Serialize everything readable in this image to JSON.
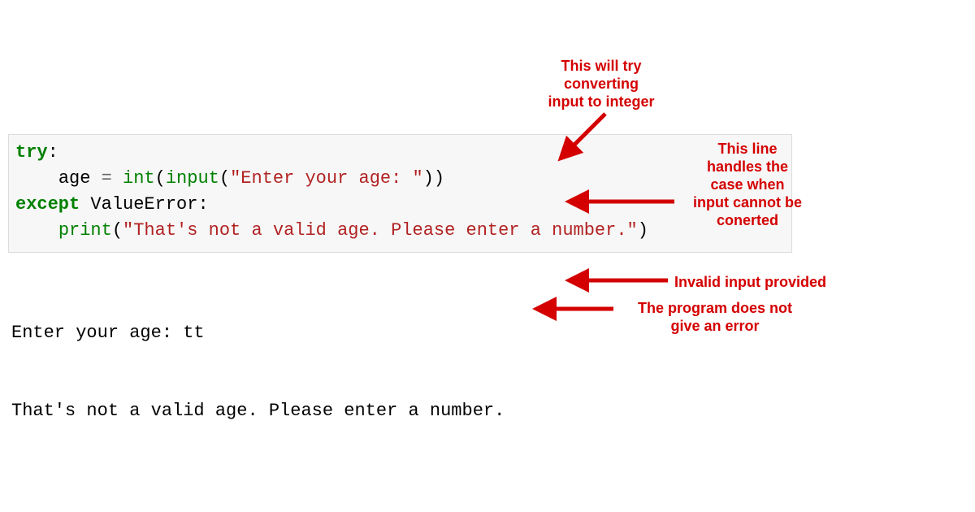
{
  "code": {
    "line1": {
      "kw": "try",
      "colon": ":"
    },
    "line2": {
      "indent": "    ",
      "var": "age ",
      "op": "= ",
      "int": "int",
      "p1": "(",
      "input": "input",
      "p2": "(",
      "str": "\"Enter your age: \"",
      "p3": "))"
    },
    "line3": {
      "kw": "except",
      "sp": " ",
      "exc": "ValueError",
      "colon": ":"
    },
    "line4": {
      "indent": "    ",
      "fn": "print",
      "p1": "(",
      "str": "\"That's not a valid age. Please enter a number.\"",
      "p2": ")"
    }
  },
  "output": {
    "line1": "Enter your age: tt",
    "line2": "That's not a valid age. Please enter a number."
  },
  "annotations": {
    "tryConvert": "This will try\nconverting\ninput to integer",
    "handlesCase": "This line\nhandles the\ncase when\ninput cannot be\nconerted",
    "invalidInput": "Invalid input provided",
    "noError": "The program does not\ngive an error"
  },
  "colors": {
    "annotation": "#d40000"
  }
}
